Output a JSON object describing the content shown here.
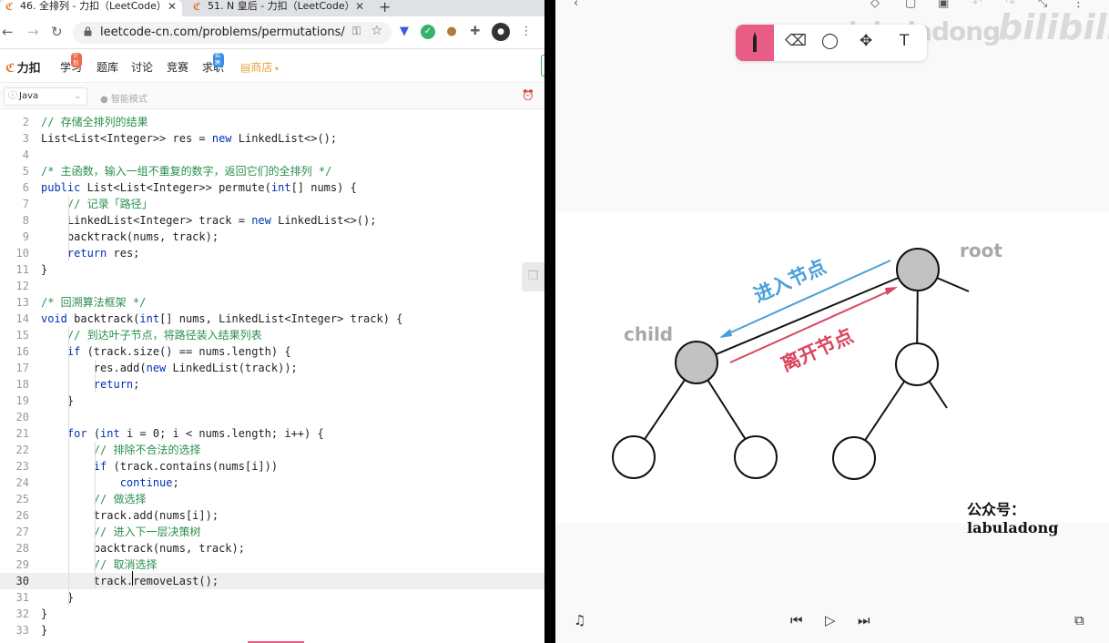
{
  "browser": {
    "tabs": [
      {
        "title": "46. 全排列 - 力扣（LeetCode）",
        "active": true
      },
      {
        "title": "51. N 皇后 - 力扣（LeetCode）",
        "active": false
      }
    ],
    "url": "leetcode-cn.com/problems/permutations/",
    "leetcode_nav": {
      "logo": "力扣",
      "items": [
        "学习",
        "题库",
        "讨论",
        "竞赛",
        "求职",
        "商店"
      ],
      "badge_study": "计划",
      "badge_jobs": "招聘"
    },
    "editor_bar": {
      "language": "Java",
      "mode": "智能模式"
    },
    "code": [
      {
        "n": "2",
        "text": "// 存储全排列的结果"
      },
      {
        "n": "3",
        "text": "List<List<Integer>> res = new LinkedList<>();"
      },
      {
        "n": "4",
        "text": ""
      },
      {
        "n": "5",
        "text": "/* 主函数，输入一组不重复的数字，返回它们的全排列 */"
      },
      {
        "n": "6",
        "text": "public List<List<Integer>> permute(int[] nums) {"
      },
      {
        "n": "7",
        "text": "    // 记录「路径」"
      },
      {
        "n": "8",
        "text": "    LinkedList<Integer> track = new LinkedList<>();"
      },
      {
        "n": "9",
        "text": "    backtrack(nums, track);"
      },
      {
        "n": "10",
        "text": "    return res;"
      },
      {
        "n": "11",
        "text": "}"
      },
      {
        "n": "12",
        "text": ""
      },
      {
        "n": "13",
        "text": "/* 回溯算法框架 */"
      },
      {
        "n": "14",
        "text": "void backtrack(int[] nums, LinkedList<Integer> track) {"
      },
      {
        "n": "15",
        "text": "    // 到达叶子节点，将路径装入结果列表"
      },
      {
        "n": "16",
        "text": "    if (track.size() == nums.length) {"
      },
      {
        "n": "17",
        "text": "        res.add(new LinkedList(track));"
      },
      {
        "n": "18",
        "text": "        return;"
      },
      {
        "n": "19",
        "text": "    }"
      },
      {
        "n": "20",
        "text": ""
      },
      {
        "n": "21",
        "text": "    for (int i = 0; i < nums.length; i++) {"
      },
      {
        "n": "22",
        "text": "        // 排除不合法的选择"
      },
      {
        "n": "23",
        "text": "        if (track.contains(nums[i]))"
      },
      {
        "n": "24",
        "text": "            continue;"
      },
      {
        "n": "25",
        "text": "        // 做选择"
      },
      {
        "n": "26",
        "text": "        track.add(nums[i]);"
      },
      {
        "n": "27",
        "text": "        // 进入下一层决策树"
      },
      {
        "n": "28",
        "text": "        backtrack(nums, track);"
      },
      {
        "n": "29",
        "text": "        // 取消选择"
      },
      {
        "n": "30",
        "text": "        track.removeLast();"
      },
      {
        "n": "31",
        "text": "    }"
      },
      {
        "n": "32",
        "text": "}"
      },
      {
        "n": "33",
        "text": "}"
      }
    ],
    "current_line": "30"
  },
  "video": {
    "watermark": "labuladong",
    "watermark_brand": "bilibili",
    "diagram": {
      "root_label": "root",
      "child_label": "child",
      "enter_label": "进入节点",
      "leave_label": "离开节点",
      "enter_color": "#4a9fd8",
      "leave_color": "#d9455f"
    },
    "credit": "公众号：labuladong",
    "accent_color": "#e85d85"
  }
}
